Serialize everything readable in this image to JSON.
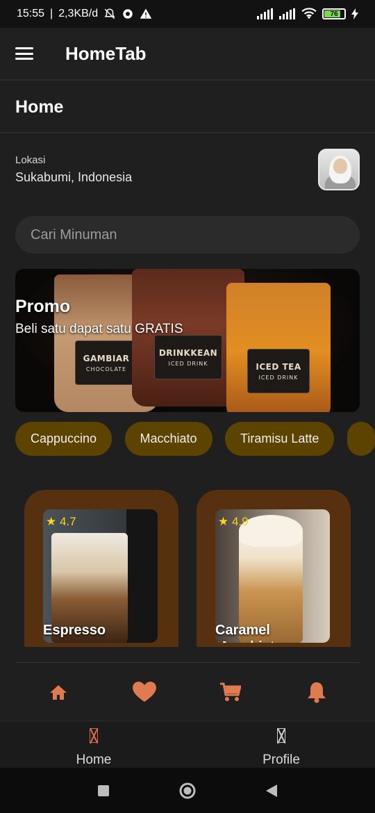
{
  "status_bar": {
    "time": "15:55",
    "speed": "2,3KB/d",
    "battery": "76"
  },
  "app_bar": {
    "title": "HomeTab"
  },
  "page": {
    "title": "Home"
  },
  "location": {
    "label": "Lokasi",
    "value": "Sukabumi, Indonesia"
  },
  "search": {
    "placeholder": "Cari Minuman"
  },
  "promo": {
    "title": "Promo",
    "subtitle": "Beli satu dapat satu GRATIS",
    "cups": [
      {
        "name": "GAMBIAR",
        "sub": "CHOCOLATE"
      },
      {
        "name": "DRINKKEAN",
        "sub": "ICED DRINK"
      },
      {
        "name": "ICED TEA",
        "sub": "ICED DRINK"
      }
    ]
  },
  "categories": [
    "Cappuccino",
    "Macchiato",
    "Tiramisu Latte"
  ],
  "products": [
    {
      "name": "Espresso",
      "rating": "★ 4.7"
    },
    {
      "name": "Caramel Macchiato",
      "rating": "★ 4.9"
    }
  ],
  "icon_bar": {
    "icons": [
      "home-icon",
      "heart-icon",
      "cart-icon",
      "bell-icon"
    ],
    "color": "#e07b4f"
  },
  "bottom_nav": {
    "items": [
      {
        "label": "Home"
      },
      {
        "label": "Profile"
      }
    ],
    "active_color": "#e06a4e"
  },
  "colors": {
    "background": "#1f1f1f",
    "chip": "#5c4300",
    "card": "#57300f",
    "rating": "#f7d61b"
  }
}
